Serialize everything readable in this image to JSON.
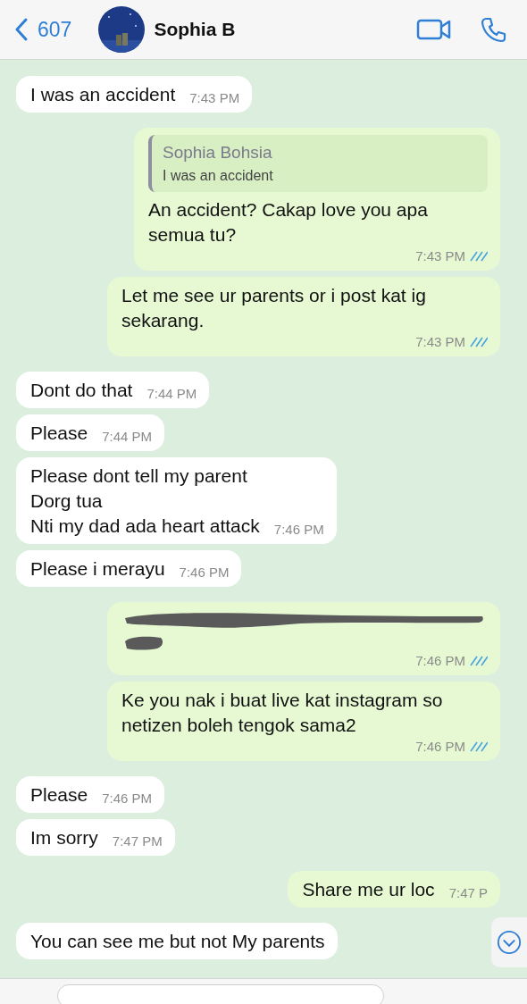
{
  "header": {
    "back_count": "607",
    "contact_name": "Sophia B"
  },
  "messages": [
    {
      "kind": "in",
      "text": "I was an accident",
      "time": "7:43 PM"
    },
    {
      "kind": "quote_out",
      "quote_name": "Sophia Bohsia",
      "quote_text": "I was an accident",
      "text": "An accident? Cakap love you apa semua tu?",
      "time": "7:43 PM",
      "read": true
    },
    {
      "kind": "out",
      "text": "Let me see ur parents or i post kat ig sekarang.",
      "time": "7:43 PM",
      "read": true
    },
    {
      "kind": "in",
      "text": "Dont do that",
      "time": "7:44 PM"
    },
    {
      "kind": "in",
      "text": "Please",
      "time": "7:44 PM"
    },
    {
      "kind": "in",
      "text": "Please dont tell my parent\nDorg tua\nNti my dad ada heart attack",
      "time": "7:46 PM"
    },
    {
      "kind": "in",
      "text": "Please i merayu",
      "time": "7:46 PM"
    },
    {
      "kind": "redacted_out",
      "time": "7:46 PM",
      "read": true
    },
    {
      "kind": "out",
      "text": "Ke you nak i buat live kat instagram so netizen boleh tengok sama2",
      "time": "7:46 PM",
      "read": true
    },
    {
      "kind": "in",
      "text": "Please",
      "time": "7:46 PM"
    },
    {
      "kind": "in",
      "text": "Im sorry",
      "time": "7:47 PM"
    },
    {
      "kind": "out",
      "text": "Share me ur loc",
      "time": "7:47 P",
      "read": false
    },
    {
      "kind": "in",
      "text": "You can see me but not My parents"
    }
  ]
}
